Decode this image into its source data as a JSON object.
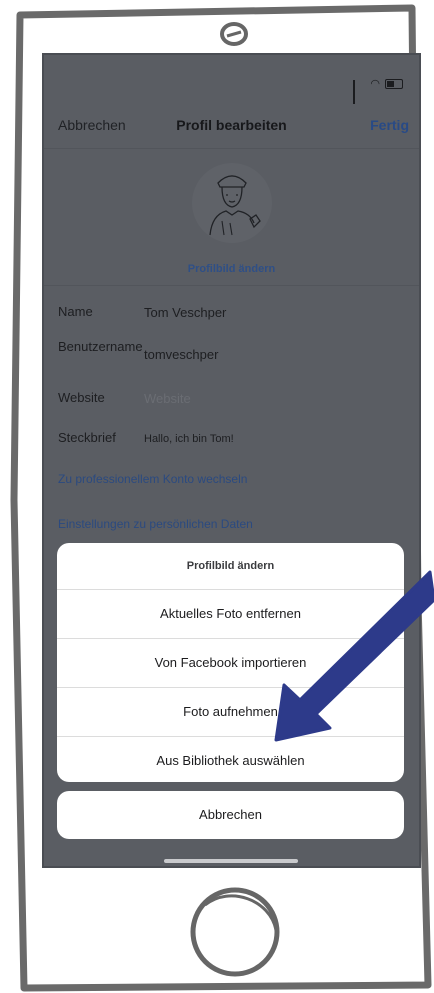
{
  "nav": {
    "cancel_label": "Abbrechen",
    "title": "Profil bearbeiten",
    "done_label": "Fertig"
  },
  "profile": {
    "change_photo_label": "Profilbild ändern"
  },
  "fields": [
    {
      "label": "Name",
      "value": "Tom Veschper"
    },
    {
      "label": "Benutzername",
      "value": "tomveschper"
    },
    {
      "label": "Website",
      "placeholder": "Website"
    },
    {
      "label": "Steckbrief",
      "value": "Hallo, ich bin Tom!"
    }
  ],
  "links": {
    "professional": "Zu professionellem Konto wechseln",
    "personal_data": "Einstellungen zu persönlichen Daten"
  },
  "action_sheet": {
    "title": "Profilbild ändern",
    "options": [
      "Aktuelles Foto entfernen",
      "Von Facebook importieren",
      "Foto aufnehmen",
      "Aus Bibliothek auswählen"
    ],
    "cancel_label": "Abbrechen"
  },
  "status_icons": [
    "signal-icon",
    "wifi-icon",
    "battery-icon"
  ],
  "colors": {
    "accent": "#2b4a80",
    "overlay": "#5a5d63",
    "annotation_arrow": "#2d3a8a"
  }
}
